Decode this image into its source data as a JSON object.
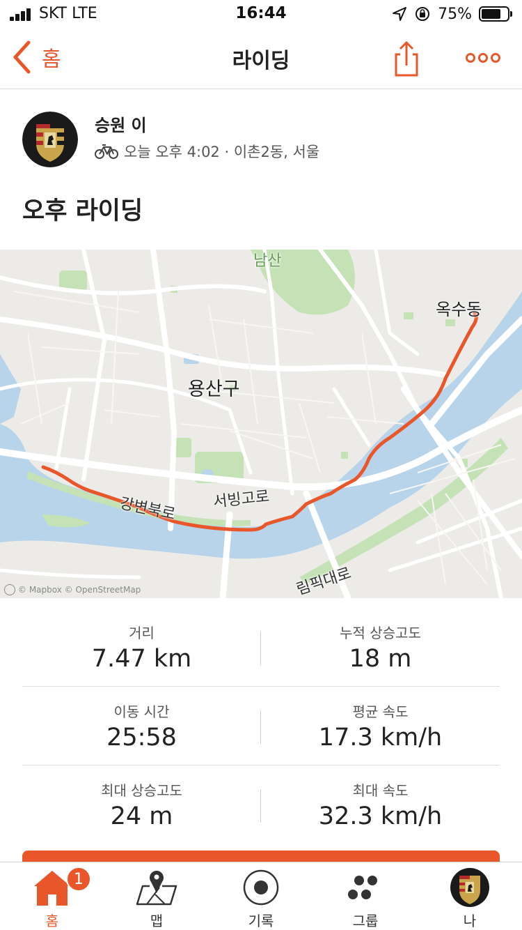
{
  "status_bar": {
    "carrier": "SKT   LTE",
    "time": "16:44",
    "battery_pct": "75%",
    "battery_level": 0.75
  },
  "nav": {
    "back_label": "홈",
    "title": "라이딩",
    "icons": [
      "chevron-left-icon",
      "share-icon",
      "more-icon"
    ]
  },
  "athlete": {
    "name": "승원 이",
    "activity_icon": "bicycle-icon",
    "meta": "오늘 오후 4:02 · 이촌2동, 서울"
  },
  "activity": {
    "title": "오후 라이딩"
  },
  "map": {
    "labels": {
      "namsan": "남산",
      "oksudong": "옥수동",
      "yongsangu": "용산구",
      "seobinggoro": "서빙고로",
      "gangbyeonbukro": "강변북로",
      "olympic": "림픽대로"
    },
    "attribution": "© Mapbox © OpenStreetMap",
    "colors": {
      "route": "#e8562a",
      "water": "#b7d4ea",
      "park": "#c4e2b6",
      "land": "#ecebe8",
      "road": "#ffffff"
    }
  },
  "stats": [
    [
      {
        "label": "거리",
        "value": "7.47 km"
      },
      {
        "label": "누적 상승고도",
        "value": "18 m"
      }
    ],
    [
      {
        "label": "이동 시간",
        "value": "25:58"
      },
      {
        "label": "평균 속도",
        "value": "17.3 km/h"
      }
    ],
    [
      {
        "label": "최대 상승고도",
        "value": "24 m"
      },
      {
        "label": "최대 속도",
        "value": "32.3 km/h"
      }
    ]
  ],
  "tabs": [
    {
      "label": "홈",
      "icon": "home-icon",
      "active": true,
      "badge": "1"
    },
    {
      "label": "맵",
      "icon": "map-icon"
    },
    {
      "label": "기록",
      "icon": "record-icon"
    },
    {
      "label": "그룹",
      "icon": "groups-icon"
    },
    {
      "label": "나",
      "icon": "profile-avatar-icon"
    }
  ],
  "accent_color": "#e8562a"
}
